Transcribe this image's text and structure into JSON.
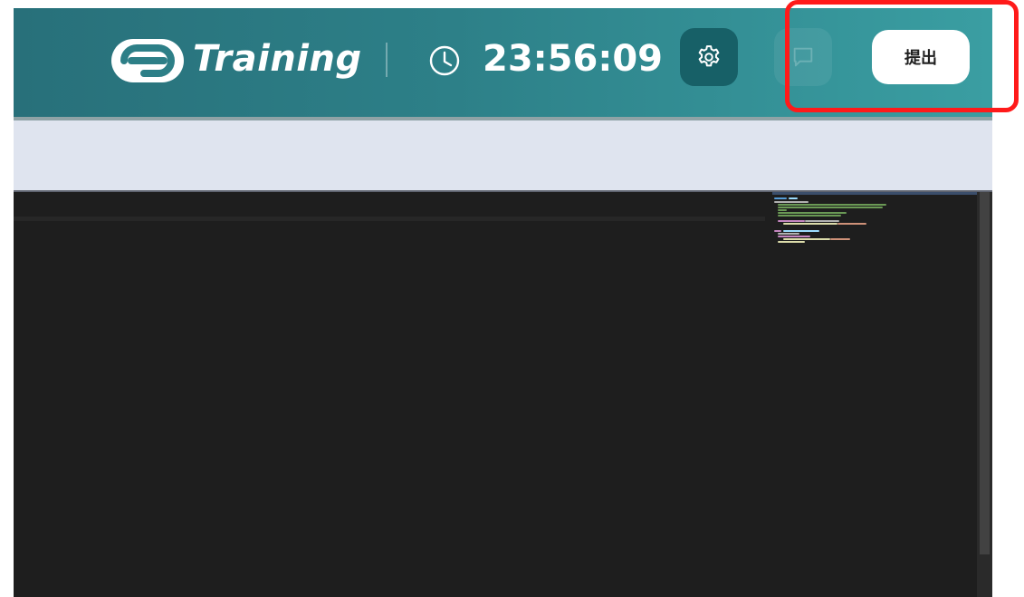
{
  "header": {
    "logo_text": "Training",
    "timer": "23:56:09",
    "settings_icon": "gear-icon",
    "chat_icon": "chat-bubble-icon",
    "submit_label": "提出"
  },
  "colors": {
    "header_start": "#28707a",
    "header_end": "#3a9ea2",
    "settings_bg": "#176067",
    "toolbar_bg": "#dfe4ef",
    "editor_bg": "#1e1e1e",
    "highlight": "#ff1a1a"
  }
}
